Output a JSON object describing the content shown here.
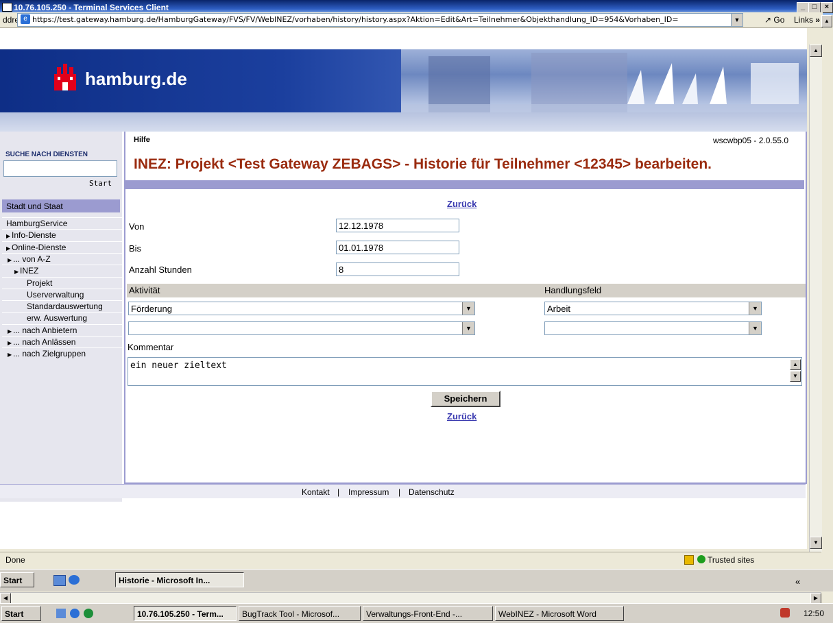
{
  "rdp_window": {
    "title": "10.76.105.250 - Terminal Services Client",
    "min": "_",
    "max": "□",
    "close": "×"
  },
  "browser": {
    "address_label": "ddress",
    "url": "https://test.gateway.hamburg.de/HamburgGateway/FVS/FV/WebINEZ/vorhaben/history/history.aspx?Aktion=Edit&Art=Teilnehmer&Objekthandlung_ID=954&Vorhaben_ID=",
    "go_label": "Go",
    "links_label": "Links",
    "status_text": "Done",
    "zone_label": "Trusted sites"
  },
  "site": {
    "logo_text": "hamburg.de",
    "search_heading": "SUCHE NACH DIENSTEN",
    "search_button": "Start",
    "section_title": "Stadt und Staat",
    "nav_items": [
      {
        "label": "HamburgService",
        "indent": 0,
        "arrow": ""
      },
      {
        "label": "Info-Dienste",
        "indent": 0,
        "arrow": "▶"
      },
      {
        "label": "Online-Dienste",
        "indent": 0,
        "arrow": "▶"
      },
      {
        "label": "... von A-Z",
        "indent": 1,
        "arrow": "▶"
      },
      {
        "label": "INEZ",
        "indent": 2,
        "arrow": "▶"
      },
      {
        "label": "Projekt",
        "indent": 3,
        "arrow": ""
      },
      {
        "label": "Userverwaltung",
        "indent": 3,
        "arrow": ""
      },
      {
        "label": "Standardauswertung",
        "indent": 3,
        "arrow": ""
      },
      {
        "label": "erw. Auswertung",
        "indent": 3,
        "arrow": ""
      },
      {
        "label": "... nach Anbietern",
        "indent": 1,
        "arrow": "▶"
      },
      {
        "label": "... nach Anlässen",
        "indent": 1,
        "arrow": "▶"
      },
      {
        "label": "... nach Zielgruppen",
        "indent": 1,
        "arrow": "▶"
      }
    ],
    "footer": {
      "kontakt": "Kontakt",
      "impressum": "Impressum",
      "datenschutz": "Datenschutz",
      "sep": "|"
    }
  },
  "form": {
    "help_label": "Hilfe",
    "version": "wscwbp05 - 2.0.55.0",
    "title": "INEZ: Projekt <Test Gateway ZEBAGS> - Historie für Teilnehmer <12345> bearbeiten.",
    "back_link": "Zurück",
    "von_label": "Von",
    "von_value": "12.12.1978",
    "bis_label": "Bis",
    "bis_value": "01.01.1978",
    "stunden_label": "Anzahl Stunden",
    "stunden_value": "8",
    "aktivitaet_header": "Aktivität",
    "handlungsfeld_header": "Handlungsfeld",
    "aktivitaet_1": "Förderung",
    "aktivitaet_2": "",
    "handlungsfeld_1": "Arbeit",
    "handlungsfeld_2": "",
    "kommentar_label": "Kommentar",
    "kommentar_value": "ein neuer zieltext",
    "save_label": "Speichern"
  },
  "inner_taskbar": {
    "start": "Start",
    "window_button": "Historie - Microsoft In...",
    "chevron": "«"
  },
  "outer_taskbar": {
    "start": "Start",
    "buttons": [
      "10.76.105.250 - Term...",
      "BugTrack Tool - Microsof...",
      "Verwaltungs-Front-End -...",
      "WebINEZ - Microsoft Word"
    ],
    "clock": "12:50"
  }
}
